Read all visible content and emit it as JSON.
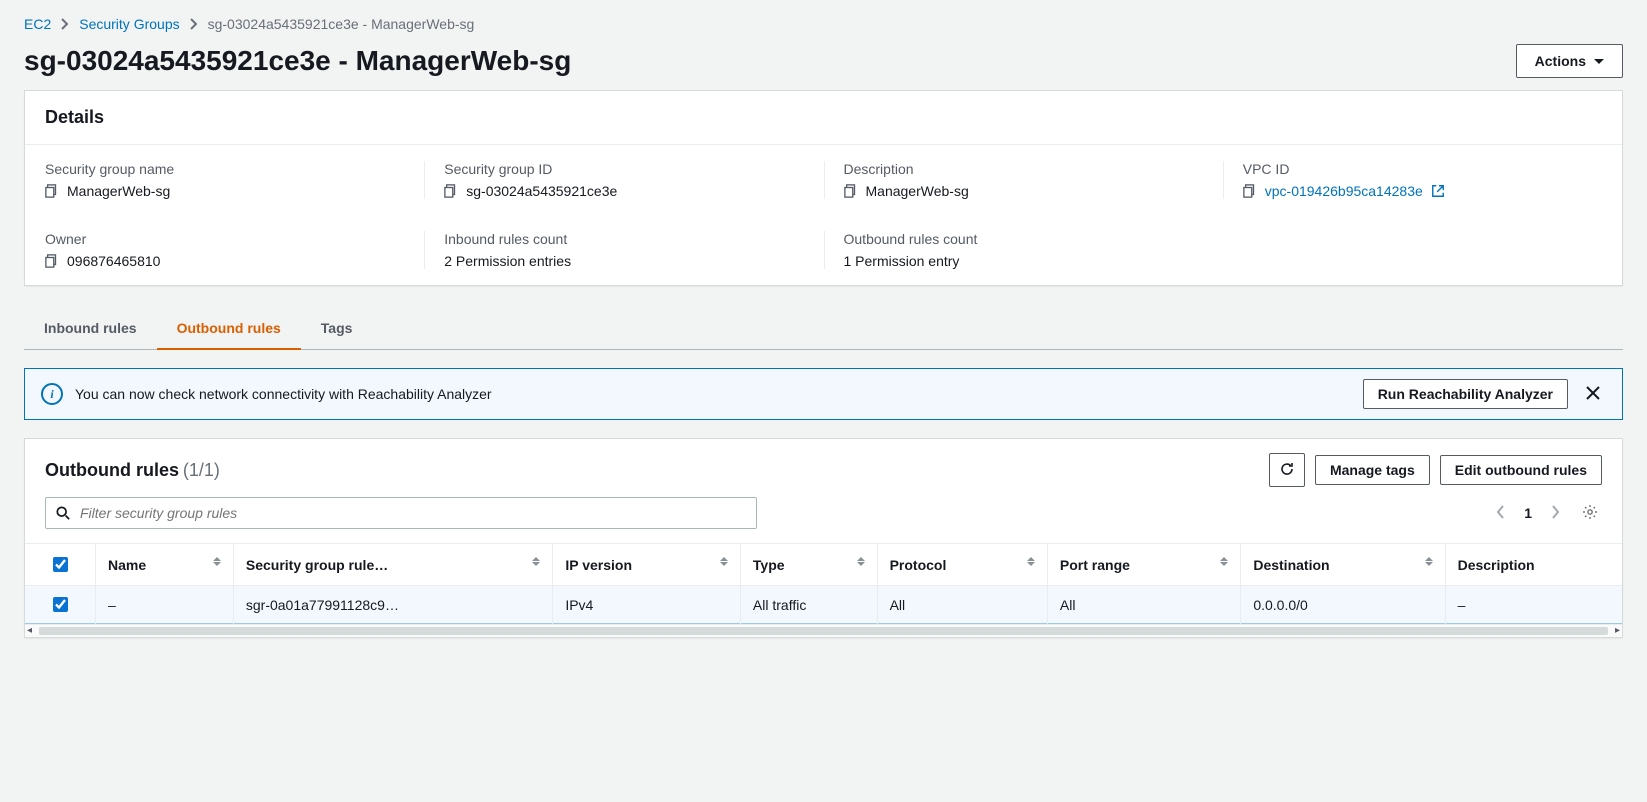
{
  "breadcrumb": {
    "ec2": "EC2",
    "sg": "Security Groups",
    "current": "sg-03024a5435921ce3e - ManagerWeb-sg"
  },
  "page_title": "sg-03024a5435921ce3e - ManagerWeb-sg",
  "actions_label": "Actions",
  "details": {
    "heading": "Details",
    "items": {
      "name_label": "Security group name",
      "name_value": "ManagerWeb-sg",
      "id_label": "Security group ID",
      "id_value": "sg-03024a5435921ce3e",
      "desc_label": "Description",
      "desc_value": "ManagerWeb-sg",
      "vpc_label": "VPC ID",
      "vpc_value": "vpc-019426b95ca14283e",
      "owner_label": "Owner",
      "owner_value": "096876465810",
      "inbound_label": "Inbound rules count",
      "inbound_value": "2 Permission entries",
      "outbound_label": "Outbound rules count",
      "outbound_value": "1 Permission entry"
    }
  },
  "tabs": {
    "inbound": "Inbound rules",
    "outbound": "Outbound rules",
    "tags": "Tags"
  },
  "alert": {
    "message": "You can now check network connectivity with Reachability Analyzer",
    "button": "Run Reachability Analyzer"
  },
  "rules": {
    "title": "Outbound rules",
    "count": "(1/1)",
    "manage_tags": "Manage tags",
    "edit": "Edit outbound rules",
    "filter_placeholder": "Filter security group rules",
    "page": "1",
    "columns": {
      "name": "Name",
      "rule_id": "Security group rule…",
      "ip_version": "IP version",
      "type": "Type",
      "protocol": "Protocol",
      "port_range": "Port range",
      "destination": "Destination",
      "description": "Description"
    },
    "row": {
      "name": "–",
      "rule_id": "sgr-0a01a77991128c9…",
      "ip_version": "IPv4",
      "type": "All traffic",
      "protocol": "All",
      "port_range": "All",
      "destination": "0.0.0.0/0",
      "description": "–"
    }
  }
}
